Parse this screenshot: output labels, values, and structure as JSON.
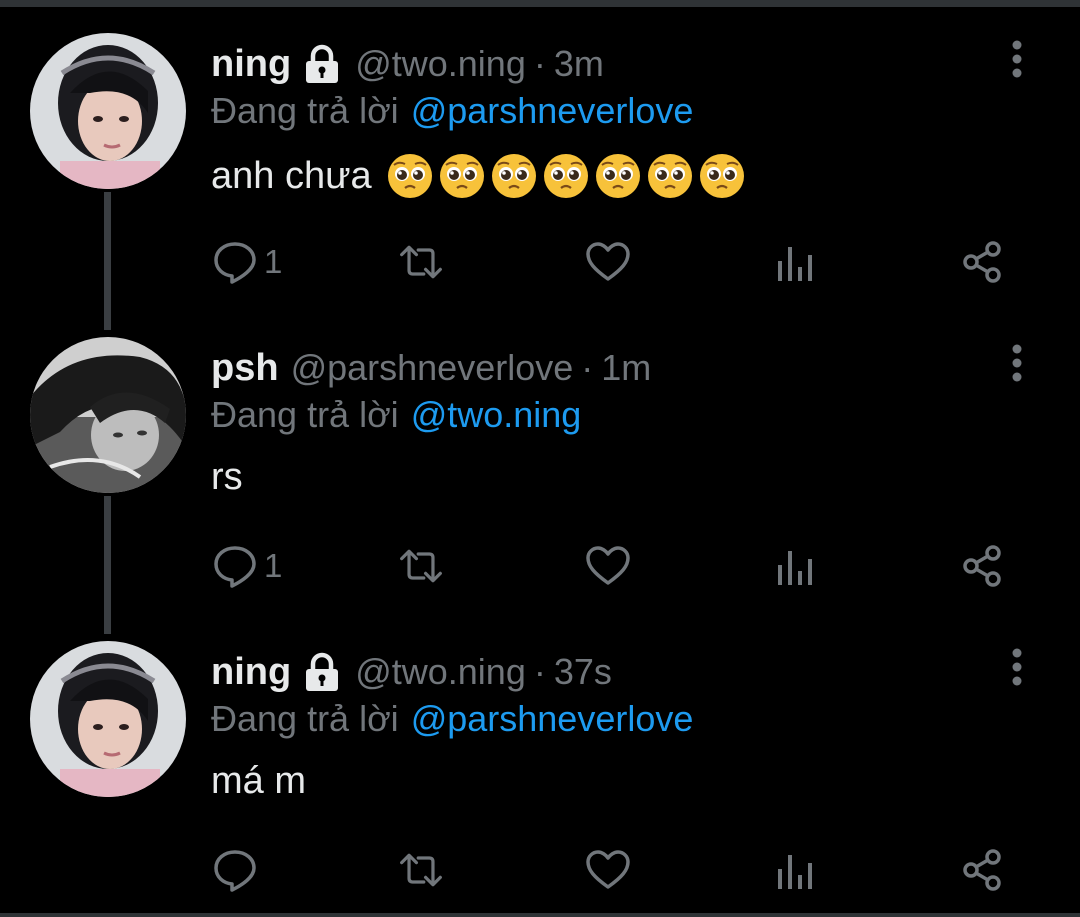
{
  "tweets": [
    {
      "name": "ning",
      "locked": true,
      "handle": "@two.ning",
      "separator": "·",
      "time": "3m",
      "reply_prefix": "Đang trả lời",
      "reply_target": "@parshneverlove",
      "text": "anh chưa",
      "emoji_count": 7,
      "emoji_name": "pleading-face-emoji",
      "reply_count": "1",
      "avatar": "ning-avatar"
    },
    {
      "name": "psh",
      "locked": false,
      "handle": "@parshneverlove",
      "separator": "·",
      "time": "1m",
      "reply_prefix": "Đang trả lời",
      "reply_target": "@two.ning",
      "text": "rs",
      "emoji_count": 0,
      "reply_count": "1",
      "avatar": "psh-avatar"
    },
    {
      "name": "ning",
      "locked": true,
      "handle": "@two.ning",
      "separator": "·",
      "time": "37s",
      "reply_prefix": "Đang trả lời",
      "reply_target": "@parshneverlove",
      "text": "má m",
      "emoji_count": 0,
      "reply_count": "",
      "avatar": "ning-avatar"
    }
  ],
  "icons": {
    "reply": "reply-icon",
    "retweet": "retweet-icon",
    "like": "heart-icon",
    "views": "views-icon",
    "share": "share-icon",
    "more": "more-icon",
    "lock": "lock-icon"
  },
  "colors": {
    "background": "#000000",
    "primary_text": "#e7e9ea",
    "secondary_text": "#71767b",
    "link": "#1d9bf0",
    "thread_line": "#3a3e42"
  }
}
